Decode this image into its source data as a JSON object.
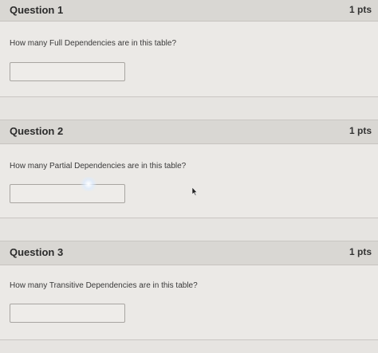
{
  "questions": [
    {
      "title": "Question 1",
      "points": "1 pts",
      "text": "How many Full Dependencies are in this table?",
      "answer": ""
    },
    {
      "title": "Question 2",
      "points": "1 pts",
      "text": "How many Partial Dependencies are in this table?",
      "answer": ""
    },
    {
      "title": "Question 3",
      "points": "1 pts",
      "text": "How many Transitive Dependencies are in this table?",
      "answer": ""
    }
  ],
  "icons": {
    "cursor": "mouse-pointer-icon"
  }
}
